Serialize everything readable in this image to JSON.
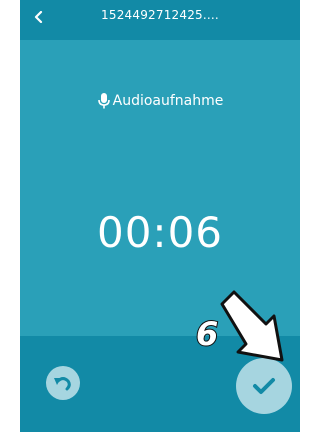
{
  "header": {
    "title": "1524492712425....",
    "back_icon": "chevron-left-icon"
  },
  "main": {
    "recording_label": "Audioaufnahme",
    "mic_icon": "microphone-icon",
    "timer": "00:06"
  },
  "footer": {
    "undo_icon": "undo-icon",
    "confirm_icon": "checkmark-icon"
  },
  "annotation": {
    "step_number": "6",
    "arrow_icon": "arrow-down-right-icon"
  },
  "colors": {
    "header_bar": "#128aa6",
    "main_background": "#2aa0b8",
    "footer_bar": "#128aa6",
    "button_fill": "#a6d5e0",
    "icon_color": "#128aa6",
    "text": "#ffffff"
  }
}
